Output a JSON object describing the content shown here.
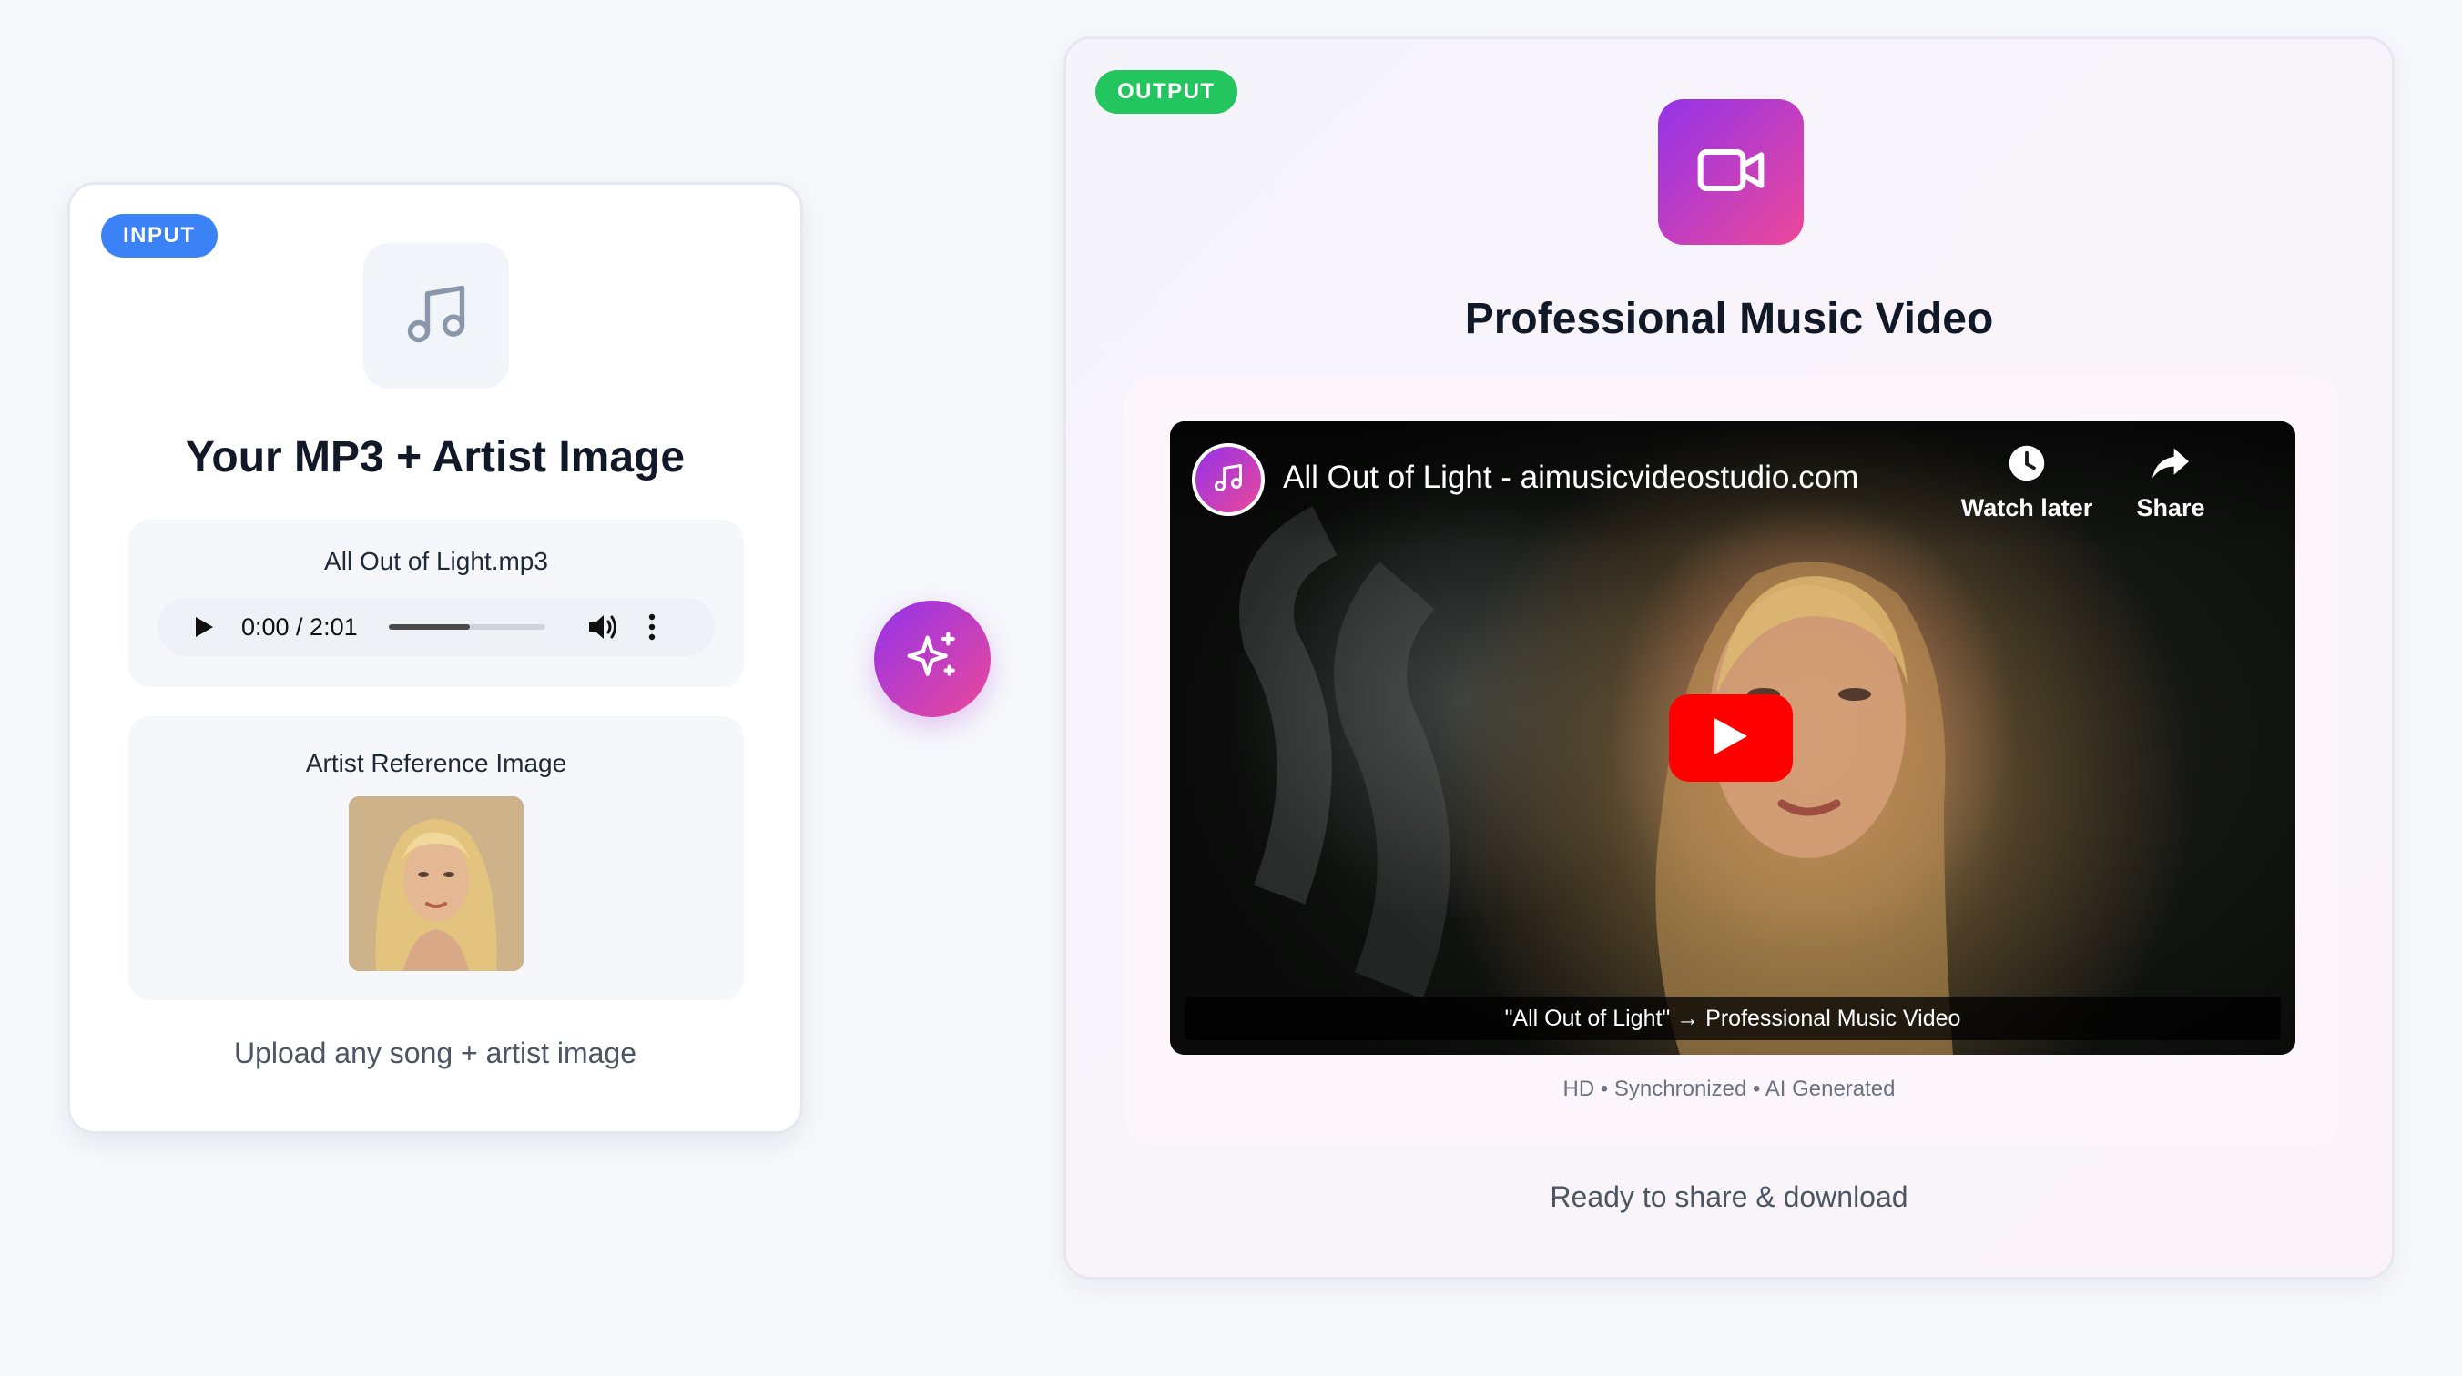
{
  "input_card": {
    "badge": "INPUT",
    "title": "Your MP3 + Artist Image",
    "audio": {
      "filename": "All Out of Light.mp3",
      "time": "0:00 / 2:01",
      "progress_fraction": 0.52
    },
    "image_label": "Artist Reference Image",
    "caption": "Upload any song + artist image",
    "icon": "music-note-icon"
  },
  "connector": {
    "icon": "sparkles-icon"
  },
  "output_card": {
    "badge": "OUTPUT",
    "icon": "video-camera-icon",
    "title": "Professional Music Video",
    "player": {
      "video_title": "All Out of Light - aimusicvideostudio.com",
      "watch_later": "Watch later",
      "share": "Share",
      "caption": "\"All Out of Light\" → Professional Music Video"
    },
    "meta": "HD • Synchronized • AI Generated",
    "caption": "Ready to share & download"
  },
  "colors": {
    "input_badge": "#3b82f6",
    "output_badge": "#22c55e",
    "gradient_start": "#9333ea",
    "gradient_end": "#ec4899",
    "youtube_red": "#ff0000"
  }
}
